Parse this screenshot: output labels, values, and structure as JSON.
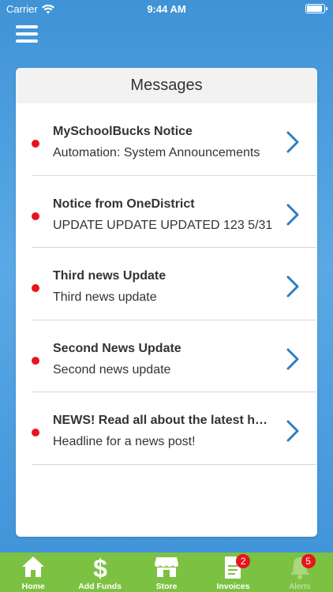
{
  "status_bar": {
    "carrier": "Carrier",
    "time": "9:44 AM"
  },
  "page": {
    "title": "Messages"
  },
  "messages": [
    {
      "title": "MySchoolBucks Notice",
      "preview": "Automation: System Announcements"
    },
    {
      "title": "Notice from OneDistrict",
      "preview": "UPDATE UPDATE UPDATED 123 5/31"
    },
    {
      "title": "Third news Update",
      "preview": "Third news update"
    },
    {
      "title": "Second News Update",
      "preview": "Second news update"
    },
    {
      "title": "NEWS! Read all about the latest headlines",
      "preview": "Headline for a news post!"
    }
  ],
  "tabs": [
    {
      "label": "Home",
      "icon": "home-icon"
    },
    {
      "label": "Add Funds",
      "icon": "dollar-icon"
    },
    {
      "label": "Store",
      "icon": "store-icon"
    },
    {
      "label": "Invoices",
      "icon": "invoice-icon",
      "badge": "2"
    },
    {
      "label": "Alerts",
      "icon": "bell-icon",
      "badge": "5"
    }
  ],
  "colors": {
    "background": "#4a9ddf",
    "tab_bar": "#7dc142",
    "unread_dot": "#e8141c",
    "chevron": "#2e7cc4",
    "badge": "#e8141c"
  }
}
